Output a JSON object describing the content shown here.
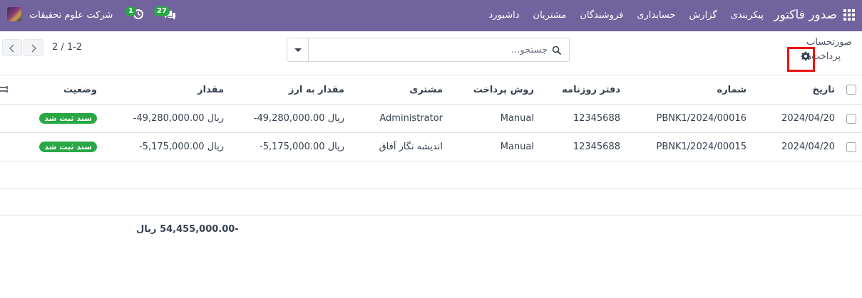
{
  "topbar": {
    "brand": "صدور فاکتور",
    "menu": [
      "داشبورد",
      "مشتریان",
      "فروشندگان",
      "حسابداری",
      "گزارش",
      "پیکربندی"
    ],
    "company": "شرکت علوم تحقیقات",
    "messages_count": "27",
    "activities_count": "1",
    "accent_color": "#71639e"
  },
  "breadcrumb": {
    "parent": "صورتحساب",
    "current": "پرداخت‌ها"
  },
  "search": {
    "placeholder": "جستجو..."
  },
  "pager": {
    "range": "1-2",
    "separator": "/",
    "total": "2"
  },
  "table": {
    "columns": [
      "تاریخ",
      "شماره",
      "دفتر روزنامه",
      "روش پرداخت",
      "مشتری",
      "مقدار به ارز",
      "مقدار",
      "وضعیت"
    ],
    "rows": [
      {
        "date": "2024/04/20",
        "number": "PBNK1/2024/00016",
        "journal": "12345688",
        "method": "Manual",
        "customer": "Administrator",
        "amount_currency": "-49,280,000.00 ریال",
        "amount": "-49,280,000.00 ریال",
        "status": "سند ثبت شد"
      },
      {
        "date": "2024/04/20",
        "number": "PBNK1/2024/00015",
        "journal": "12345688",
        "method": "Manual",
        "customer": "اندیشه نگار آفاق",
        "amount_currency": "-5,175,000.00 ریال",
        "amount": "-5,175,000.00 ریال",
        "status": "سند ثبت شد"
      }
    ],
    "total": "-54,455,000.00 ریال",
    "status_color": "#28a745"
  }
}
